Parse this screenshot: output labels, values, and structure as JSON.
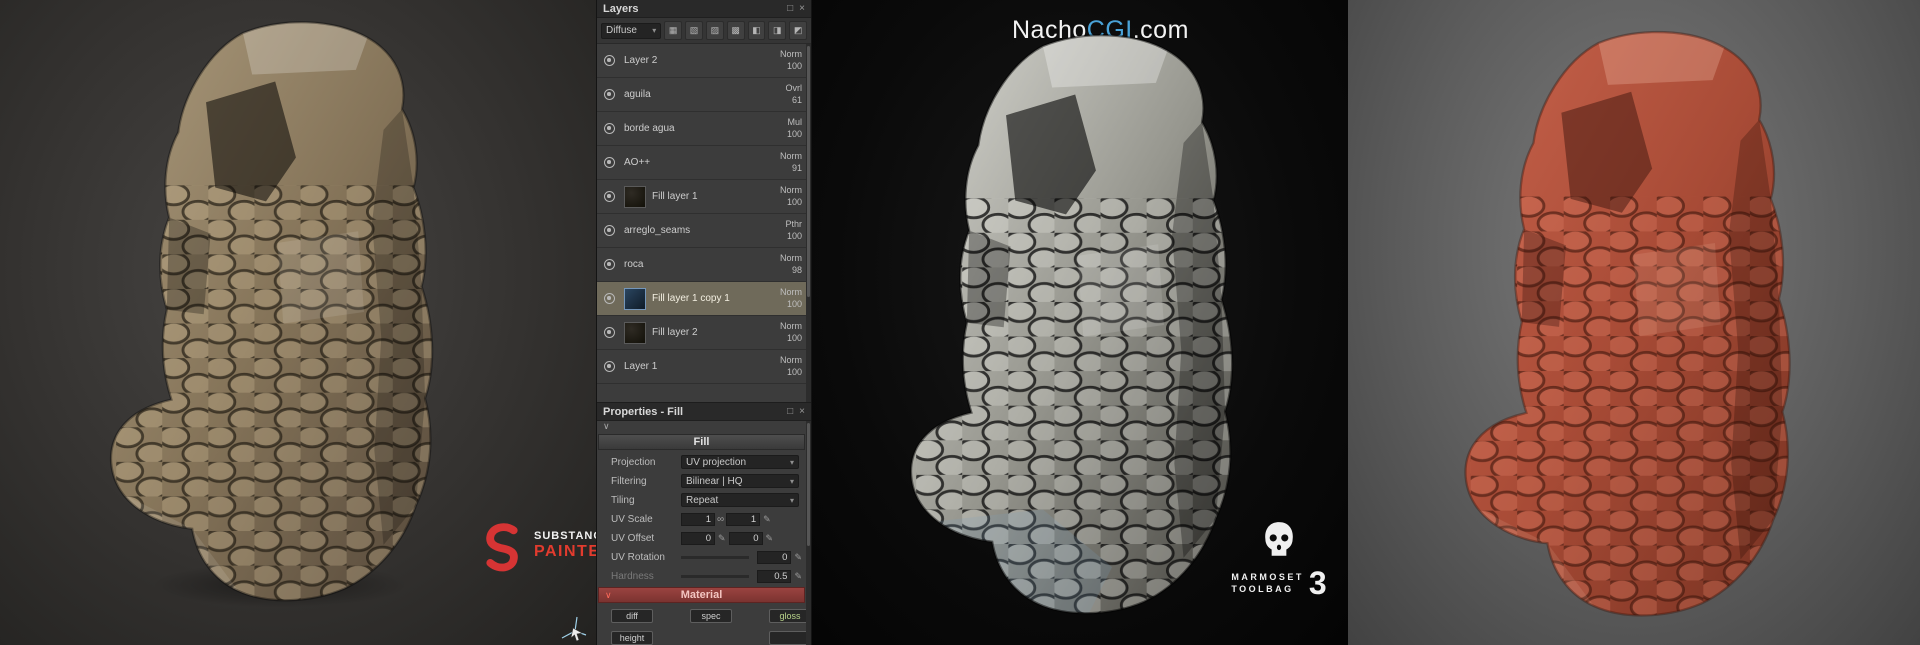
{
  "icons": {
    "caret": "▾",
    "pen": "✎",
    "link": "∞",
    "chevron_open": "∨",
    "panel_float": "□",
    "panel_close": "×",
    "toolbar": [
      "▦",
      "▧",
      "▨",
      "▩",
      "◧",
      "◨",
      "◩"
    ]
  },
  "layers_panel": {
    "title": "Layers",
    "blend_mode": "Diffuse",
    "rows": [
      {
        "name": "Layer 2",
        "mode": "Norm",
        "opacity": "100"
      },
      {
        "name": "aguila",
        "mode": "Ovrl",
        "opacity": "61"
      },
      {
        "name": "borde agua",
        "mode": "Mul",
        "opacity": "100"
      },
      {
        "name": "AO++",
        "mode": "Norm",
        "opacity": "91"
      },
      {
        "name": "Fill layer 1",
        "mode": "Norm",
        "opacity": "100"
      },
      {
        "name": "arreglo_seams",
        "mode": "Pthr",
        "opacity": "100"
      },
      {
        "name": "roca",
        "mode": "Norm",
        "opacity": "98"
      },
      {
        "name": "Fill layer 1 copy 1",
        "mode": "Norm",
        "opacity": "100"
      },
      {
        "name": "Fill layer 2",
        "mode": "Norm",
        "opacity": "100"
      },
      {
        "name": "Layer 1",
        "mode": "Norm",
        "opacity": "100"
      }
    ]
  },
  "properties_panel": {
    "title": "Properties - Fill",
    "section_title": "Fill",
    "rows": {
      "projection": {
        "label": "Projection",
        "value": "UV projection"
      },
      "filtering": {
        "label": "Filtering",
        "value": "Bilinear | HQ"
      },
      "tiling": {
        "label": "Tiling",
        "value": "Repeat"
      },
      "uv_scale": {
        "label": "UV Scale",
        "x": "1",
        "y": "1"
      },
      "uv_offset": {
        "label": "UV Offset",
        "x": "0",
        "y": "0"
      },
      "uv_rotation": {
        "label": "UV Rotation",
        "value": "0"
      },
      "hardness": {
        "label": "Hardness",
        "value": "0.5"
      }
    },
    "material_title": "Material",
    "channels": [
      "diff",
      "spec",
      "gloss"
    ],
    "channels_row2": [
      "height"
    ]
  },
  "watermark": {
    "white1": "Nacho",
    "blue": "CGI",
    "white2": ".com"
  },
  "substance_logo": {
    "title": "SUBSTANCE",
    "subtitle": "PAINTER"
  },
  "marmoset_logo": {
    "word1": "MARMOSET",
    "word2": "TOOLBAG",
    "number": "3"
  },
  "colors": {
    "material_header": "#8a3c38",
    "selected_layer": "#6f6a5a",
    "watermark_blue": "#4aa3d8",
    "substance_red": "#e23b2e"
  }
}
